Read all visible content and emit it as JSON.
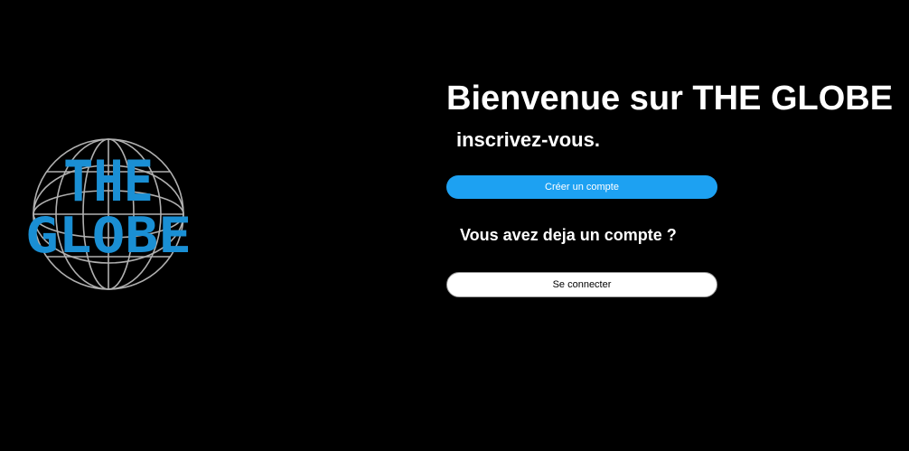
{
  "logo": {
    "line1": "THE",
    "line2": "GLOBE",
    "icon": "globe-logo",
    "text_color": "#1a8fd4",
    "globe_color": "#b0b0b0"
  },
  "main": {
    "title": "Bienvenue sur THE GLOBE",
    "subtitle": "inscrivez-vous.",
    "create_account_label": "Créer un compte",
    "question": "Vous avez deja un compte ?",
    "login_label": "Se connecter"
  },
  "colors": {
    "background": "#000000",
    "primary_button": "#1da1f2",
    "secondary_button": "#ffffff"
  }
}
